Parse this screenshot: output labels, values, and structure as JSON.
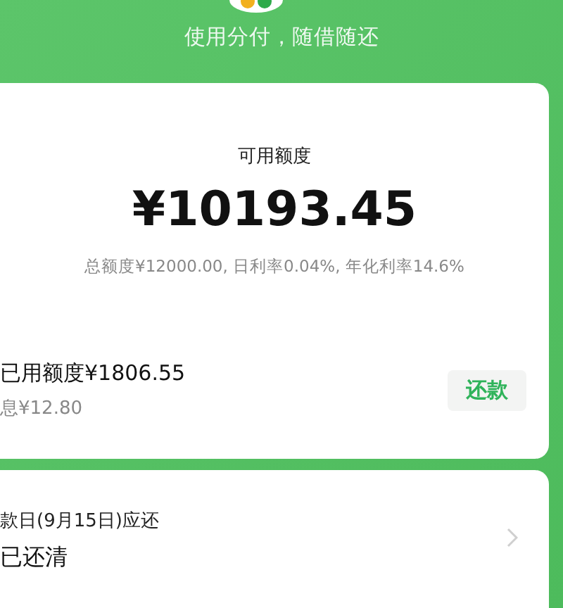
{
  "header": {
    "subtitle": "使用分付，随借随还"
  },
  "credit_card": {
    "label": "可用额度",
    "amount": "¥10193.45",
    "details": "总额度¥12000.00, 日利率0.04%, 年化利率14.6%",
    "used": "已用额度¥1806.55",
    "interest": "息¥12.80",
    "repay_button": "还款"
  },
  "due_card": {
    "label": "款日(9月15日)应还",
    "status": "已还清"
  }
}
